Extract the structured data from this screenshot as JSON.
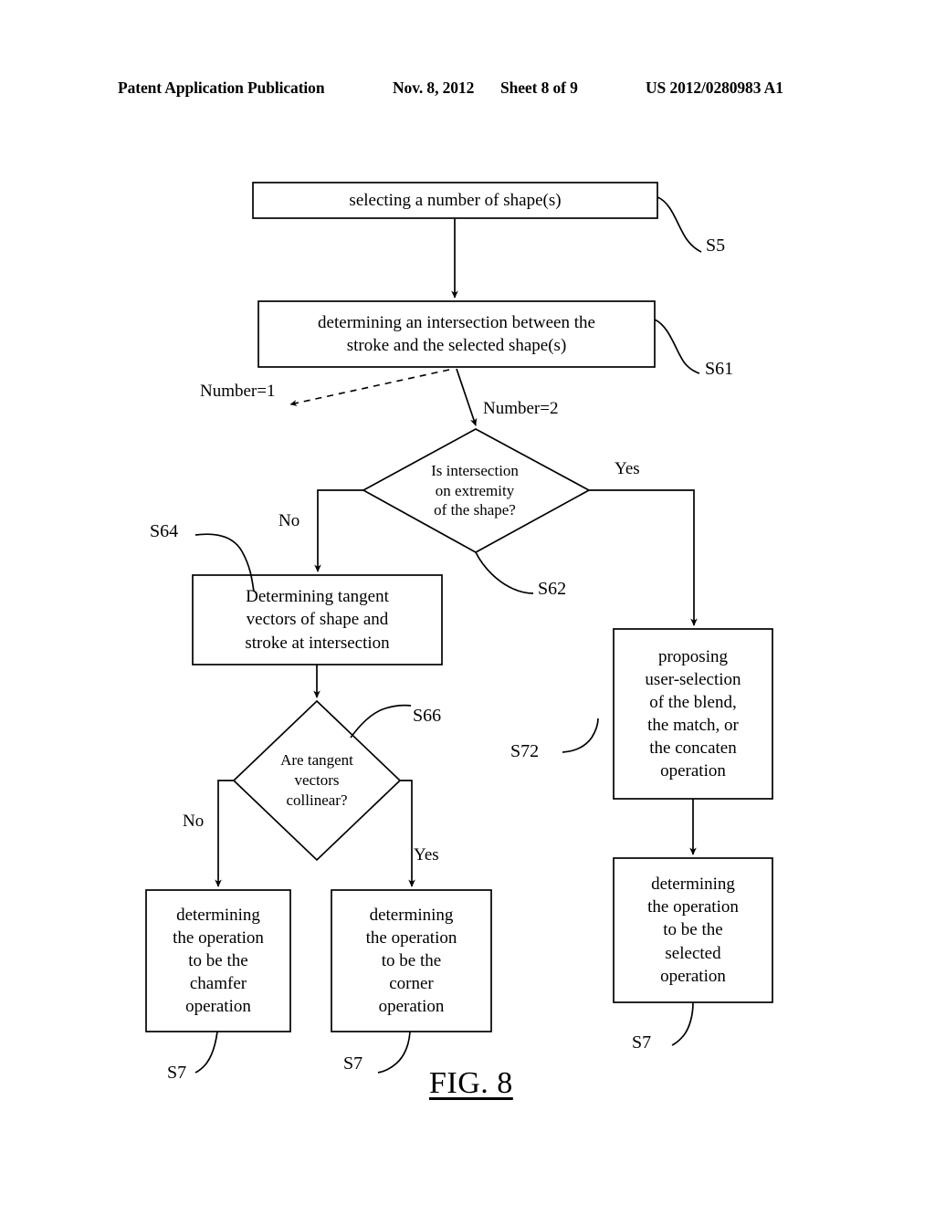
{
  "header": {
    "publication": "Patent Application Publication",
    "date": "Nov. 8, 2012",
    "sheet": "Sheet 8 of 9",
    "number": "US 2012/0280983 A1"
  },
  "figure": {
    "caption": "FIG. 8"
  },
  "nodes": {
    "select_shapes": "selecting a number of shape(s)",
    "determine_intersection": "determining an intersection between the\nstroke and the selected shape(s)",
    "decision_extremity": "Is intersection\non extremity\nof the shape?",
    "determine_tangent": "Determining tangent\nvectors of shape and\nstroke at intersection",
    "decision_collinear": "Are tangent\nvectors\ncollinear?",
    "chamfer": "determining\nthe operation\nto be the\nchamfer\noperation",
    "corner": "determining\nthe operation\nto be the\ncorner\noperation",
    "proposing": "proposing\nuser-selection\nof the blend,\nthe match, or\nthe concaten\noperation",
    "selected_op": "determining\nthe operation\nto be the\nselected\noperation"
  },
  "edge_labels": {
    "number_1": "Number=1",
    "number_2": "Number=2",
    "extremity_no": "No",
    "extremity_yes": "Yes",
    "collinear_no": "No",
    "collinear_yes": "Yes"
  },
  "reference_labels": {
    "s5": "S5",
    "s61": "S61",
    "s62": "S62",
    "s64": "S64",
    "s66": "S66",
    "s72": "S72",
    "s7_chamfer": "S7",
    "s7_corner": "S7",
    "s7_selected": "S7"
  },
  "colors": {
    "ink": "#000000",
    "paper": "#ffffff"
  }
}
